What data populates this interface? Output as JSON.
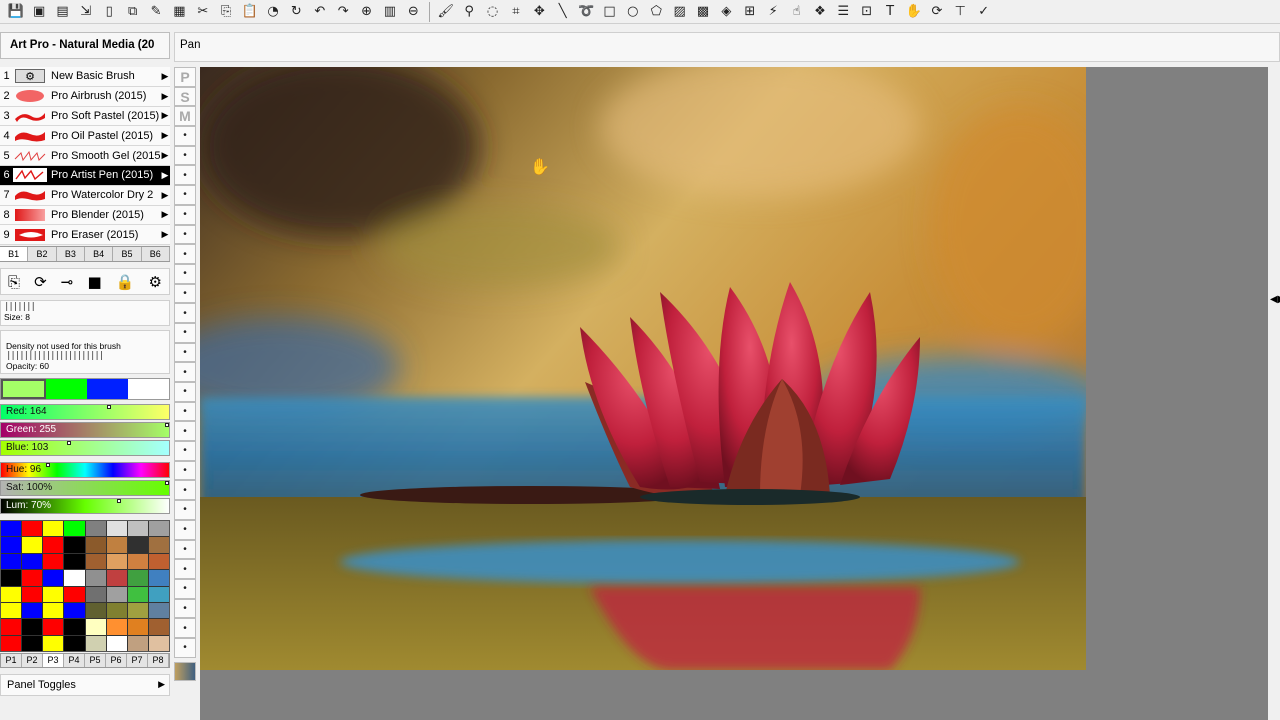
{
  "toolbar": {
    "icons": [
      "save-icon",
      "open-icon",
      "new-icon",
      "export-icon",
      "page-icon",
      "copy-icon",
      "pencil-icon",
      "table-icon",
      "scissors-icon",
      "copy-doc-icon",
      "paste-icon",
      "fill-icon",
      "rotate-icon",
      "undo-icon",
      "redo-icon",
      "zoom-icon",
      "fit-icon",
      "zoom-out-icon",
      "brush-icon",
      "eyedropper-icon",
      "bucket-icon",
      "crop-icon",
      "move-icon",
      "line-icon",
      "lasso-icon",
      "rectangle-icon",
      "ellipse-icon",
      "freehand-select-icon",
      "gradient-icon",
      "pattern-icon",
      "texture-icon",
      "mesh-icon",
      "warp-icon",
      "smudge-icon",
      "clone-icon",
      "layers-icon",
      "stamp-icon",
      "text-icon",
      "hand-icon",
      "refresh-icon",
      "ruler-icon",
      "script-icon"
    ]
  },
  "panel": {
    "title": "Art Pro - Natural Media (20"
  },
  "status": {
    "text": "Pan"
  },
  "brushes": [
    {
      "num": "1",
      "name": "New Basic Brush",
      "swatch": "gear",
      "selected": false
    },
    {
      "num": "2",
      "name": "Pro Airbrush (2015)",
      "swatch": "blob-soft",
      "selected": false
    },
    {
      "num": "3",
      "name": "Pro Soft Pastel (2015)",
      "swatch": "stroke",
      "selected": false
    },
    {
      "num": "4",
      "name": "Pro Oil Pastel (2015)",
      "swatch": "stroke-thick",
      "selected": false
    },
    {
      "num": "5",
      "name": "Pro Smooth Gel (2015)",
      "swatch": "scribble",
      "selected": false
    },
    {
      "num": "6",
      "name": "Pro Artist Pen (2015)",
      "swatch": "pen",
      "selected": true
    },
    {
      "num": "7",
      "name": "Pro Watercolor Dry 2",
      "swatch": "stroke-thick",
      "selected": false
    },
    {
      "num": "8",
      "name": "Pro Blender (2015)",
      "swatch": "blend",
      "selected": false
    },
    {
      "num": "9",
      "name": "Pro Eraser (2015)",
      "swatch": "eraser",
      "selected": false
    }
  ],
  "bank_tabs": [
    "B1",
    "B2",
    "B3",
    "B4",
    "B5",
    "B6"
  ],
  "brush_tools": [
    "folder-open-icon",
    "refresh-icon",
    "slider-icon",
    "square-icon",
    "lock-icon",
    "gear-icon"
  ],
  "size": {
    "label": "Size: 8",
    "ticks": "|||||||"
  },
  "density": {
    "label": "Density not used for this brush",
    "ticks": "||||||||||||||||||||||",
    "opacity_label": "Opacity: 60"
  },
  "current_colors": [
    "#a4ff67",
    "#00ff00",
    "#0020ff",
    "#ffffff"
  ],
  "sliders": [
    {
      "label": "Red: 164",
      "bg": "linear-gradient(90deg,#00ff67,#ffff67)",
      "mark": 0.64,
      "dark": false
    },
    {
      "label": "Green: 255",
      "bg": "linear-gradient(90deg,#a40067,#a4ff67)",
      "mark": 1.0,
      "dark": true
    },
    {
      "label": "Blue: 103",
      "bg": "linear-gradient(90deg,#a4ff00,#a4ffff)",
      "mark": 0.4,
      "dark": false
    },
    {
      "label": "Hue: 96",
      "bg": "linear-gradient(90deg,#ff0000,#ffff00,#00ff00,#00ffff,#0000ff,#ff00ff,#ff0000)",
      "mark": 0.27,
      "dark": false
    },
    {
      "label": "Sat: 100%",
      "bg": "linear-gradient(90deg,#b3b3b3,#66ff00)",
      "mark": 1.0,
      "dark": false
    },
    {
      "label": "Lum: 70%",
      "bg": "linear-gradient(90deg,#000000,#66ff00,#ffffff)",
      "mark": 0.7,
      "dark": true
    }
  ],
  "palette": [
    "#0000ff",
    "#ff0000",
    "#ffff00",
    "#00ff00",
    "#808080",
    "#e0e0e0",
    "#c0c0c0",
    "#a0a0a0",
    "#0000ff",
    "#ffff00",
    "#ff0000",
    "#000000",
    "#8b5a2b",
    "#c08040",
    "#303030",
    "#a07040",
    "#0000ff",
    "#0000ff",
    "#ff0000",
    "#000000",
    "#a06030",
    "#e0a060",
    "#d08040",
    "#c06030",
    "#000000",
    "#ff0000",
    "#0000ff",
    "#ffffff",
    "#909090",
    "#c04040",
    "#40a040",
    "#4080c0",
    "#ffff00",
    "#ff0000",
    "#ffff00",
    "#ff0000",
    "#707070",
    "#a0a0a0",
    "#40c040",
    "#40a0c0",
    "#ffff00",
    "#0000ff",
    "#ffff00",
    "#0000ff",
    "#606030",
    "#808030",
    "#a0a040",
    "#6080a0",
    "#ff0000",
    "#000000",
    "#ff0000",
    "#000000",
    "#ffffc0",
    "#ff9030",
    "#e08020",
    "#a06030",
    "#ff0000",
    "#000000",
    "#ffff00",
    "#000000",
    "#d0d0b0",
    "#ffffff",
    "#c0a080",
    "#e0c0a0"
  ],
  "palette_tabs": [
    "P1",
    "P2",
    "P3",
    "P4",
    "P5",
    "P6",
    "P7",
    "P8"
  ],
  "panel_toggles": {
    "label": "Panel Toggles"
  },
  "vstrip": [
    "P",
    "S",
    "M"
  ]
}
